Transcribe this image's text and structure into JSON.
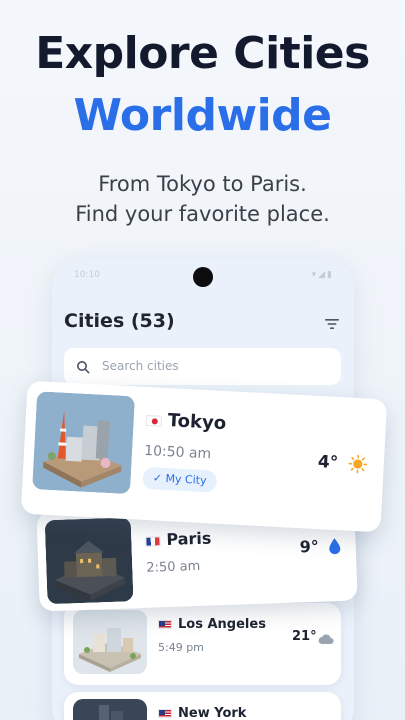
{
  "hero": {
    "title_line1": "Explore Cities",
    "title_line2": "Worldwide",
    "subtitle_line1": "From Tokyo to Paris.",
    "subtitle_line2": "Find your favorite place."
  },
  "phone": {
    "status_time": "10:10",
    "header_title": "Cities (53)",
    "search_placeholder": "Search cities"
  },
  "cities": [
    {
      "name": "Tokyo",
      "flag": "japan-flag",
      "time": "10:50 am",
      "temp": "4°",
      "weather_icon": "sun-icon",
      "badge": "My City"
    },
    {
      "name": "Paris",
      "flag": "france-flag",
      "time": "2:50 am",
      "temp": "9°",
      "weather_icon": "raindrop-icon"
    },
    {
      "name": "Los Angeles",
      "flag": "usa-flag",
      "time": "5:49 pm",
      "temp": "21°",
      "weather_icon": "cloud-icon"
    },
    {
      "name": "New York",
      "flag": "usa-flag"
    }
  ],
  "colors": {
    "accent": "#2a6ee8",
    "title": "#141a2e",
    "sun": "#f5a623",
    "rain": "#2a6ee8"
  }
}
